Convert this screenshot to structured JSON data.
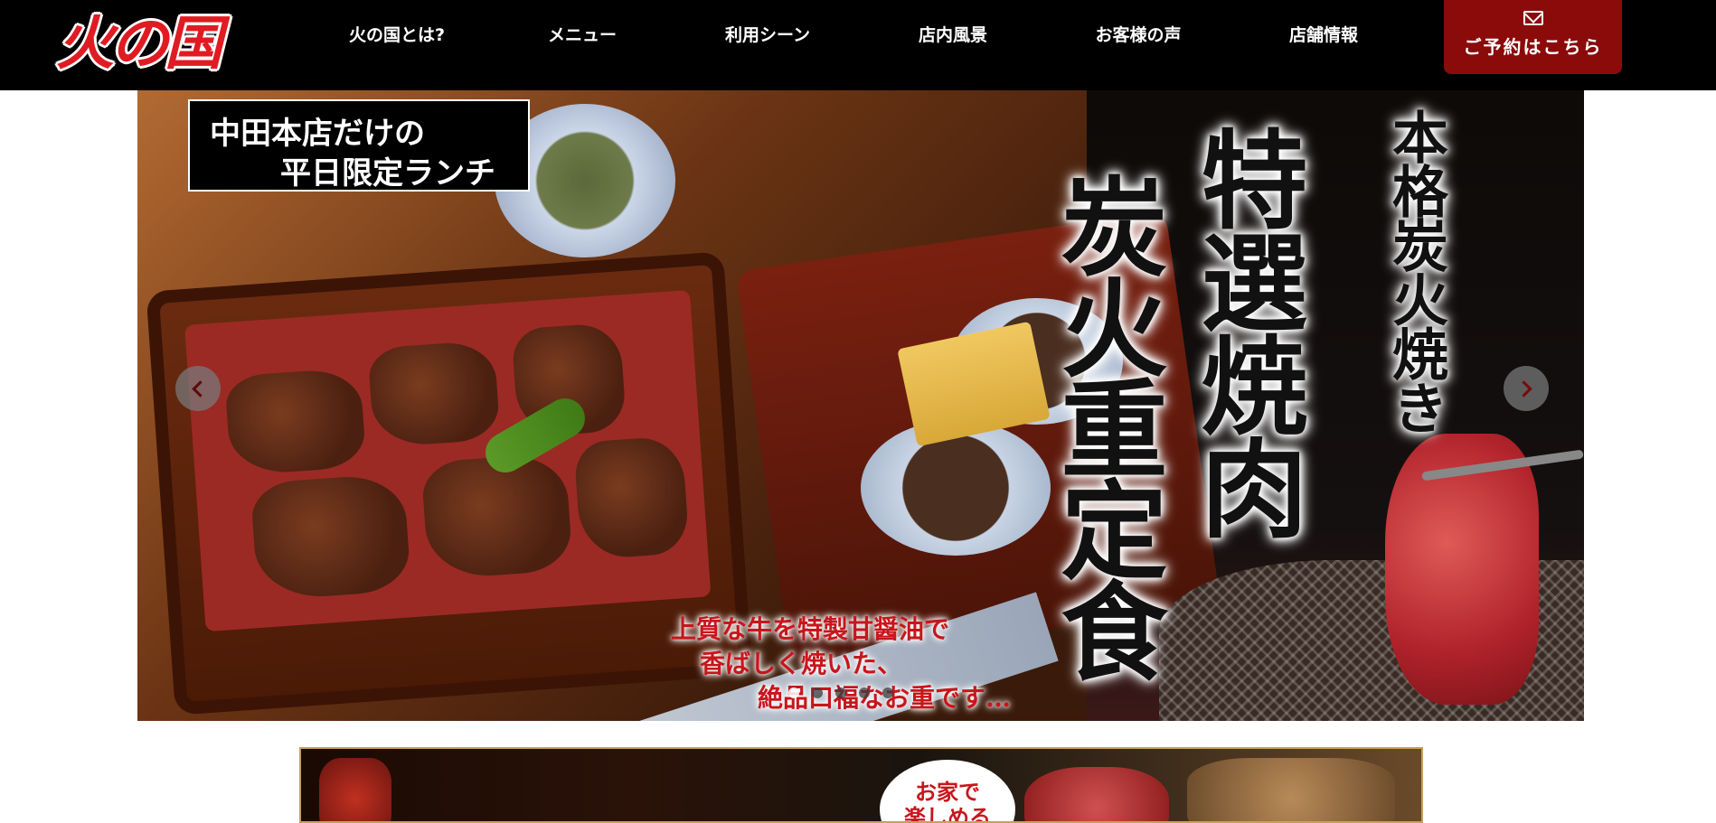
{
  "header": {
    "logo": "火の国",
    "nav": [
      {
        "label": "火の国とは?"
      },
      {
        "label": "メニュー"
      },
      {
        "label": "利用シーン"
      },
      {
        "label": "店内風景"
      },
      {
        "label": "お客様の声"
      },
      {
        "label": "店舗情報"
      }
    ],
    "reserve_label": "ご予約はこちら",
    "reserve_icon": "mail-icon"
  },
  "slider": {
    "badge_line1": "中田本店だけの",
    "badge_line2": "平日限定ランチ",
    "vertical_big1": "特選焼肉",
    "vertical_big2": "炭火重定食",
    "vertical_small": "本格炭火焼き",
    "red_line1": "上質な牛を特製甘醤油で",
    "red_line2": "香ばしく焼いた、",
    "red_line3": "絶品口福なお重です…",
    "dots_total": 5,
    "dots_active": 1
  },
  "banner": {
    "bubble_text": "お家で\n楽しめる"
  },
  "colors": {
    "header_bg": "#000000",
    "logo_red": "#e11b22",
    "reserve_bg": "#8b0b0b",
    "text_red": "#c7161c"
  }
}
